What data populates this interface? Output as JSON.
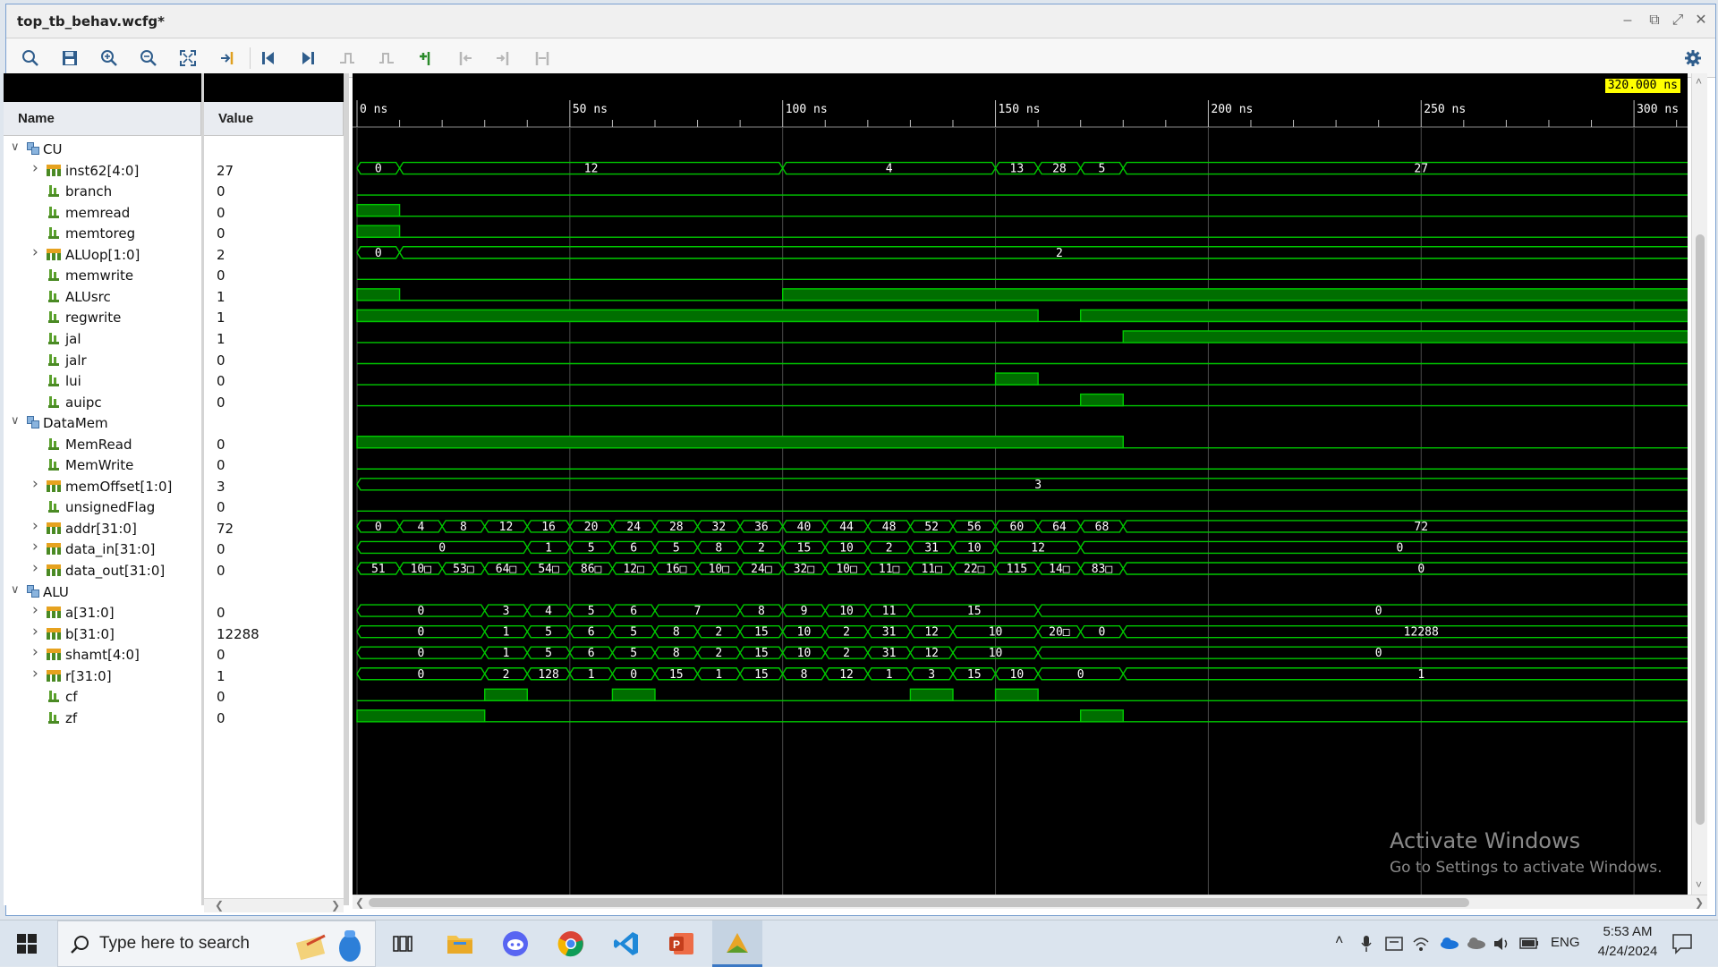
{
  "window": {
    "title": "top_tb_behav.wcfg*"
  },
  "toolbar": {
    "items": [
      "search-icon",
      "save-icon",
      "zoom-in-icon",
      "zoom-out-icon",
      "zoom-fit-icon",
      "goto-cursor-icon",
      "goto-start-icon",
      "goto-end-icon",
      "prev-transition-icon",
      "next-transition-icon",
      "add-marker-icon",
      "prev-marker-icon",
      "next-marker-icon",
      "swap-cursors-icon"
    ],
    "settings_icon": "gear-icon"
  },
  "columns": {
    "name": "Name",
    "value": "Value"
  },
  "cursor_time": "320.000 ns",
  "time_axis": {
    "ticks": [
      "0 ns",
      "50 ns",
      "100 ns",
      "150 ns",
      "200 ns",
      "250 ns",
      "300 ns"
    ],
    "max_ns": 320
  },
  "signals": [
    {
      "kind": "group",
      "name": "CU",
      "value": ""
    },
    {
      "kind": "bus",
      "name": "inst62[4:0]",
      "value": "27",
      "segments": [
        [
          0,
          10,
          "0"
        ],
        [
          10,
          100,
          "12"
        ],
        [
          100,
          150,
          "4"
        ],
        [
          150,
          160,
          "13"
        ],
        [
          160,
          170,
          "28"
        ],
        [
          170,
          180,
          "5"
        ],
        [
          180,
          320,
          "27"
        ]
      ]
    },
    {
      "kind": "bit",
      "name": "branch",
      "value": "0",
      "highs": []
    },
    {
      "kind": "bit",
      "name": "memread",
      "value": "0",
      "highs": [
        [
          0,
          10
        ]
      ]
    },
    {
      "kind": "bit",
      "name": "memtoreg",
      "value": "0",
      "highs": [
        [
          0,
          10
        ]
      ]
    },
    {
      "kind": "bus",
      "name": "ALUop[1:0]",
      "value": "2",
      "segments": [
        [
          0,
          10,
          "0"
        ],
        [
          10,
          320,
          "2"
        ]
      ]
    },
    {
      "kind": "bit",
      "name": "memwrite",
      "value": "0",
      "highs": []
    },
    {
      "kind": "bit",
      "name": "ALUsrc",
      "value": "1",
      "highs": [
        [
          0,
          10
        ],
        [
          100,
          320
        ]
      ]
    },
    {
      "kind": "bit",
      "name": "regwrite",
      "value": "1",
      "highs": [
        [
          0,
          160
        ],
        [
          170,
          320
        ]
      ]
    },
    {
      "kind": "bit",
      "name": "jal",
      "value": "1",
      "highs": [
        [
          180,
          320
        ]
      ]
    },
    {
      "kind": "bit",
      "name": "jalr",
      "value": "0",
      "highs": []
    },
    {
      "kind": "bit",
      "name": "lui",
      "value": "0",
      "highs": [
        [
          150,
          160
        ]
      ]
    },
    {
      "kind": "bit",
      "name": "auipc",
      "value": "0",
      "highs": [
        [
          170,
          180
        ]
      ]
    },
    {
      "kind": "group",
      "name": "DataMem",
      "value": ""
    },
    {
      "kind": "bit",
      "name": "MemRead",
      "value": "0",
      "highs": [
        [
          0,
          180
        ]
      ]
    },
    {
      "kind": "bit",
      "name": "MemWrite",
      "value": "0",
      "highs": []
    },
    {
      "kind": "bus",
      "name": "memOffset[1:0]",
      "value": "3",
      "segments": [
        [
          0,
          320,
          "3"
        ]
      ]
    },
    {
      "kind": "bit",
      "name": "unsignedFlag",
      "value": "0",
      "highs": []
    },
    {
      "kind": "bus",
      "name": "addr[31:0]",
      "value": "72",
      "segments": [
        [
          0,
          10,
          "0"
        ],
        [
          10,
          20,
          "4"
        ],
        [
          20,
          30,
          "8"
        ],
        [
          30,
          40,
          "12"
        ],
        [
          40,
          50,
          "16"
        ],
        [
          50,
          60,
          "20"
        ],
        [
          60,
          70,
          "24"
        ],
        [
          70,
          80,
          "28"
        ],
        [
          80,
          90,
          "32"
        ],
        [
          90,
          100,
          "36"
        ],
        [
          100,
          110,
          "40"
        ],
        [
          110,
          120,
          "44"
        ],
        [
          120,
          130,
          "48"
        ],
        [
          130,
          140,
          "52"
        ],
        [
          140,
          150,
          "56"
        ],
        [
          150,
          160,
          "60"
        ],
        [
          160,
          170,
          "64"
        ],
        [
          170,
          180,
          "68"
        ],
        [
          180,
          320,
          "72"
        ]
      ]
    },
    {
      "kind": "bus",
      "name": "data_in[31:0]",
      "value": "0",
      "segments": [
        [
          0,
          40,
          "0"
        ],
        [
          40,
          50,
          "1"
        ],
        [
          50,
          60,
          "5"
        ],
        [
          60,
          70,
          "6"
        ],
        [
          70,
          80,
          "5"
        ],
        [
          80,
          90,
          "8"
        ],
        [
          90,
          100,
          "2"
        ],
        [
          100,
          110,
          "15"
        ],
        [
          110,
          120,
          "10"
        ],
        [
          120,
          130,
          "2"
        ],
        [
          130,
          140,
          "31"
        ],
        [
          140,
          150,
          "10"
        ],
        [
          150,
          170,
          "12"
        ],
        [
          170,
          320,
          "0"
        ]
      ]
    },
    {
      "kind": "bus",
      "name": "data_out[31:0]",
      "value": "0",
      "segments": [
        [
          0,
          10,
          "51"
        ],
        [
          10,
          20,
          "10□"
        ],
        [
          20,
          30,
          "53□"
        ],
        [
          30,
          40,
          "64□"
        ],
        [
          40,
          50,
          "54□"
        ],
        [
          50,
          60,
          "86□"
        ],
        [
          60,
          70,
          "12□"
        ],
        [
          70,
          80,
          "16□"
        ],
        [
          80,
          90,
          "10□"
        ],
        [
          90,
          100,
          "24□"
        ],
        [
          100,
          110,
          "32□"
        ],
        [
          110,
          120,
          "10□"
        ],
        [
          120,
          130,
          "11□"
        ],
        [
          130,
          140,
          "11□"
        ],
        [
          140,
          150,
          "22□"
        ],
        [
          150,
          160,
          "115"
        ],
        [
          160,
          170,
          "14□"
        ],
        [
          170,
          180,
          "83□"
        ],
        [
          180,
          320,
          "0"
        ]
      ]
    },
    {
      "kind": "group",
      "name": "ALU",
      "value": ""
    },
    {
      "kind": "bus",
      "name": "a[31:0]",
      "value": "0",
      "segments": [
        [
          0,
          30,
          "0"
        ],
        [
          30,
          40,
          "3"
        ],
        [
          40,
          50,
          "4"
        ],
        [
          50,
          60,
          "5"
        ],
        [
          60,
          70,
          "6"
        ],
        [
          70,
          90,
          "7"
        ],
        [
          90,
          100,
          "8"
        ],
        [
          100,
          110,
          "9"
        ],
        [
          110,
          120,
          "10"
        ],
        [
          120,
          130,
          "11"
        ],
        [
          130,
          160,
          "15"
        ],
        [
          160,
          320,
          "0"
        ]
      ]
    },
    {
      "kind": "bus",
      "name": "b[31:0]",
      "value": "12288",
      "segments": [
        [
          0,
          30,
          "0"
        ],
        [
          30,
          40,
          "1"
        ],
        [
          40,
          50,
          "5"
        ],
        [
          50,
          60,
          "6"
        ],
        [
          60,
          70,
          "5"
        ],
        [
          70,
          80,
          "8"
        ],
        [
          80,
          90,
          "2"
        ],
        [
          90,
          100,
          "15"
        ],
        [
          100,
          110,
          "10"
        ],
        [
          110,
          120,
          "2"
        ],
        [
          120,
          130,
          "31"
        ],
        [
          130,
          140,
          "12"
        ],
        [
          140,
          160,
          "10"
        ],
        [
          160,
          170,
          "20□"
        ],
        [
          170,
          180,
          "0"
        ],
        [
          180,
          320,
          "12288"
        ]
      ]
    },
    {
      "kind": "bus",
      "name": "shamt[4:0]",
      "value": "0",
      "segments": [
        [
          0,
          30,
          "0"
        ],
        [
          30,
          40,
          "1"
        ],
        [
          40,
          50,
          "5"
        ],
        [
          50,
          60,
          "6"
        ],
        [
          60,
          70,
          "5"
        ],
        [
          70,
          80,
          "8"
        ],
        [
          80,
          90,
          "2"
        ],
        [
          90,
          100,
          "15"
        ],
        [
          100,
          110,
          "10"
        ],
        [
          110,
          120,
          "2"
        ],
        [
          120,
          130,
          "31"
        ],
        [
          130,
          140,
          "12"
        ],
        [
          140,
          160,
          "10"
        ],
        [
          160,
          320,
          "0"
        ]
      ]
    },
    {
      "kind": "bus",
      "name": "r[31:0]",
      "value": "1",
      "segments": [
        [
          0,
          30,
          "0"
        ],
        [
          30,
          40,
          "2"
        ],
        [
          40,
          50,
          "128"
        ],
        [
          50,
          60,
          "1"
        ],
        [
          60,
          70,
          "0"
        ],
        [
          70,
          80,
          "15"
        ],
        [
          80,
          90,
          "1"
        ],
        [
          90,
          100,
          "15"
        ],
        [
          100,
          110,
          "8"
        ],
        [
          110,
          120,
          "12"
        ],
        [
          120,
          130,
          "1"
        ],
        [
          130,
          140,
          "3"
        ],
        [
          140,
          150,
          "15"
        ],
        [
          150,
          160,
          "10"
        ],
        [
          160,
          180,
          "0"
        ],
        [
          180,
          320,
          "1"
        ]
      ]
    },
    {
      "kind": "bit",
      "name": "cf",
      "value": "0",
      "highs": [
        [
          30,
          40
        ],
        [
          60,
          70
        ],
        [
          130,
          140
        ],
        [
          150,
          160
        ]
      ]
    },
    {
      "kind": "bit",
      "name": "zf",
      "value": "0",
      "highs": [
        [
          0,
          30
        ],
        [
          170,
          180
        ]
      ]
    }
  ],
  "watermark": {
    "line1": "Activate Windows",
    "line2": "Go to Settings to activate Windows."
  },
  "taskbar": {
    "search_placeholder": "Type here to search",
    "language": "ENG",
    "time": "5:53 AM",
    "date": "4/24/2024"
  },
  "colors": {
    "wave": "#00c800",
    "wave_fill": "#006e00",
    "grid": "#4a4a4a",
    "cursor_label": "#ffff00"
  }
}
